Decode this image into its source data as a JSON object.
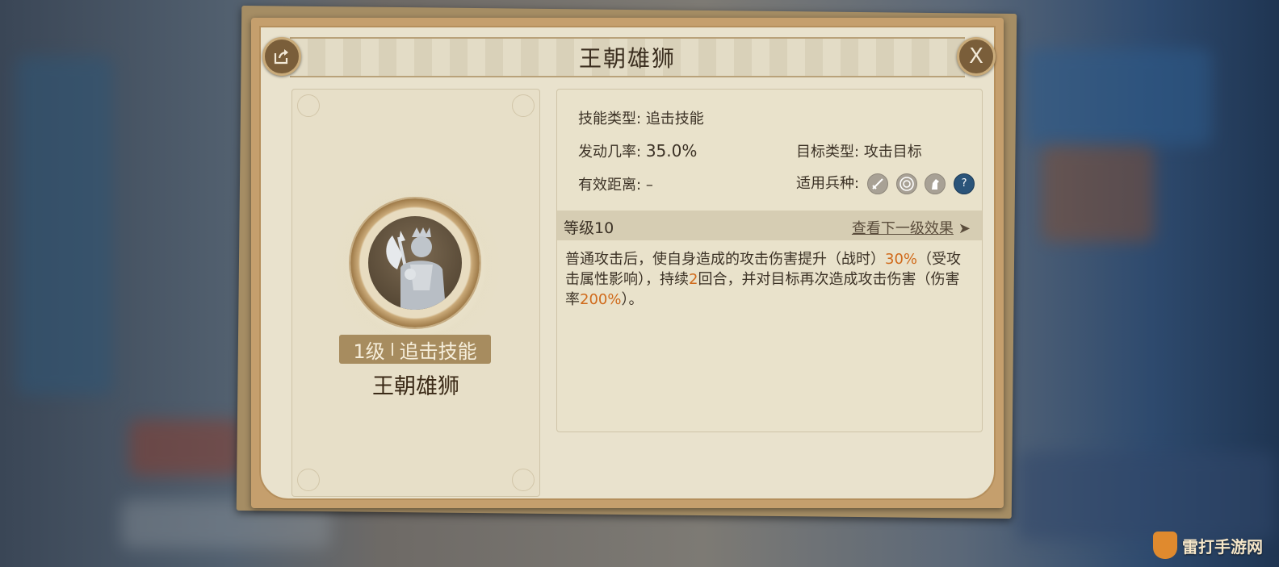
{
  "dialog": {
    "title": "王朝雄狮",
    "close_label": "X"
  },
  "skill_card": {
    "level_text": "1级",
    "type_text": "追击技能",
    "name": "王朝雄狮"
  },
  "info": {
    "skill_type_label": "技能类型:",
    "skill_type_value": "追击技能",
    "trigger_rate_label": "发动几率:",
    "trigger_rate_value": "35.0%",
    "target_type_label": "目标类型:",
    "target_type_value": "攻击目标",
    "range_label": "有效距离:",
    "range_value": "–",
    "troop_types_label": "适用兵种:",
    "troop_type_icons": [
      "sword-icon",
      "target-icon",
      "horse-icon",
      "question-icon"
    ]
  },
  "level": {
    "label": "等级10",
    "next_link": "查看下一级效果",
    "arrow": "➤"
  },
  "description": {
    "p1": "普通攻击后，使自身造成的攻击伤害提升（战时）",
    "p1_highlight": "30%",
    "p2": "（受攻击属性影响），持续",
    "p2_highlight": "2",
    "p3": "回合，并对目标再次造成攻击伤害（伤害率",
    "p3_highlight": "200%",
    "p4": "）。"
  },
  "colors": {
    "highlight": "#d06a1b",
    "panel_bg": "#e9e2cb",
    "frame": "#c59f6d"
  },
  "watermark": {
    "text": "雷打手游网"
  }
}
